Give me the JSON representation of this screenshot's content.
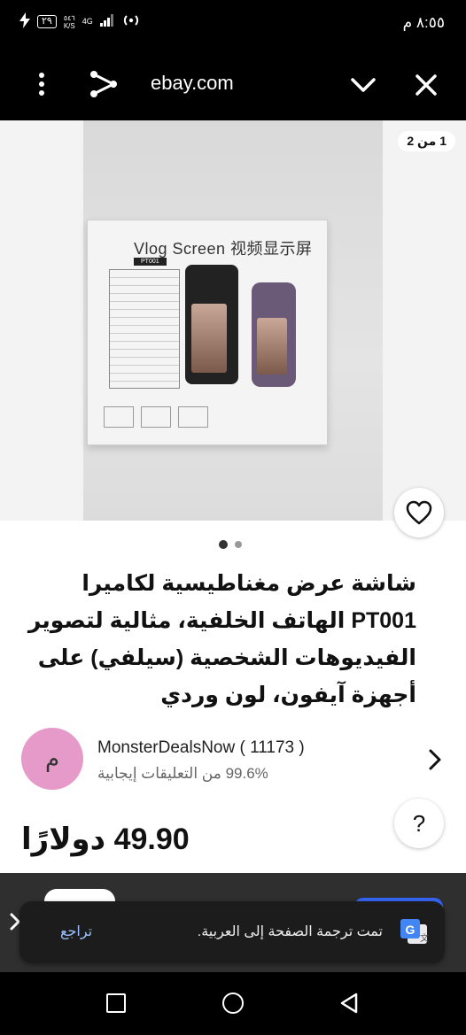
{
  "status_bar": {
    "time": "٨:٥٥ م",
    "battery": "٢٩",
    "net_speed_value": "٥٤٦",
    "net_speed_unit": "K/S",
    "network": "4G"
  },
  "browser": {
    "url": "ebay.com"
  },
  "gallery": {
    "counter": "1 من 2",
    "box_title": "Vlog Screen 视频显示屏",
    "box_model": "PT001",
    "active_index": 1,
    "total": 2
  },
  "listing": {
    "title": "شاشة عرض مغناطيسية لكاميرا PT001 الهاتف الخلفية، مثالية لتصوير الفيديوهات الشخصية (سيلفي) على أجهزة آيفون، لون وردي",
    "price": "49.90 دولارًا"
  },
  "seller": {
    "avatar_letter": "م",
    "name": "MonsterDealsNow ( 11173 )",
    "feedback": "99.6% من التعليقات إيجابية"
  },
  "help": {
    "label": "?"
  },
  "translate_toast": {
    "message": "تمت ترجمة الصفحة إلى العربية.",
    "undo_label": "تراجع",
    "icon_letter": "G"
  },
  "colors": {
    "accent": "#3665f3",
    "avatar": "#e69ac9",
    "toast_link": "#9cc0ff"
  }
}
